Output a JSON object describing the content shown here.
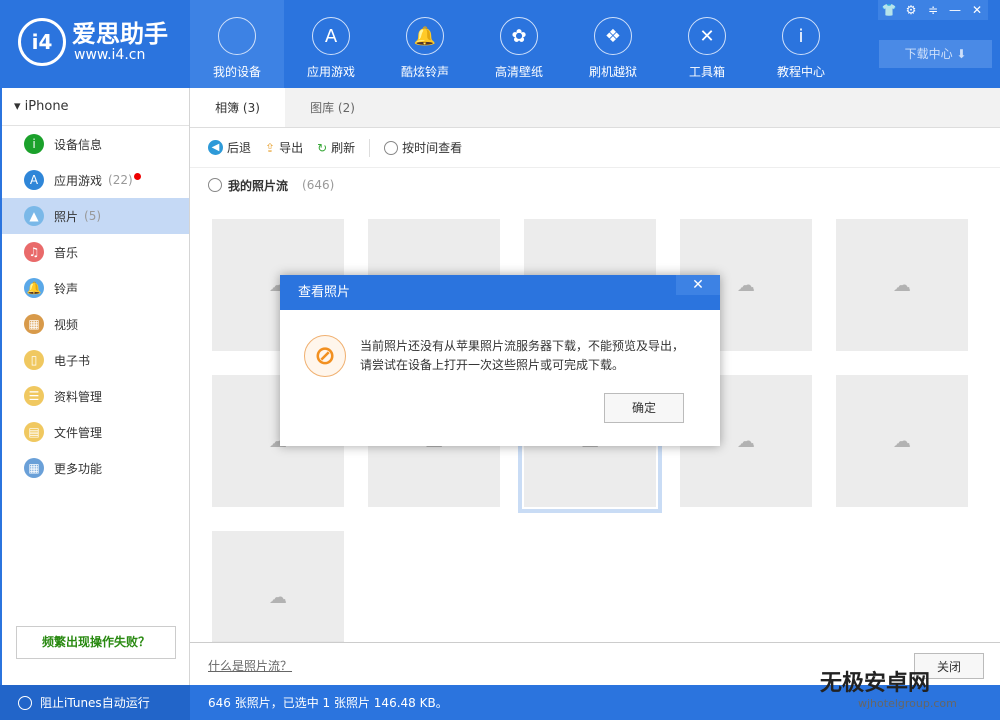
{
  "header": {
    "logo_title": "爱思助手",
    "logo_url": "www.i4.cn",
    "logo_mark": "i4",
    "nav": [
      {
        "label": "我的设备",
        "icon": "apple-icon",
        "glyph": ""
      },
      {
        "label": "应用游戏",
        "icon": "app-store-icon",
        "glyph": "A"
      },
      {
        "label": "酷炫铃声",
        "icon": "bell-icon",
        "glyph": "🔔"
      },
      {
        "label": "高清壁纸",
        "icon": "flower-icon",
        "glyph": "✿"
      },
      {
        "label": "刷机越狱",
        "icon": "box-icon",
        "glyph": "❖"
      },
      {
        "label": "工具箱",
        "icon": "tools-icon",
        "glyph": "✕"
      },
      {
        "label": "教程中心",
        "icon": "info-icon",
        "glyph": "i"
      }
    ],
    "window_buttons": [
      "👕",
      "⚙",
      "≑",
      "—",
      "✕"
    ],
    "download_center": "下载中心 ⬇"
  },
  "sidebar": {
    "device": "iPhone",
    "items": [
      {
        "label": "设备信息",
        "count": "",
        "color": "#1ba12b",
        "glyph": "i"
      },
      {
        "label": "应用游戏",
        "count": "(22)",
        "color": "#2f86d8",
        "glyph": "A"
      },
      {
        "label": "照片",
        "count": "(5)",
        "color": "#7ab8e8",
        "glyph": "▲"
      },
      {
        "label": "音乐",
        "count": "",
        "color": "#e96a6a",
        "glyph": "♫"
      },
      {
        "label": "铃声",
        "count": "",
        "color": "#5aa8e8",
        "glyph": "🔔"
      },
      {
        "label": "视频",
        "count": "",
        "color": "#d89a4a",
        "glyph": "▦"
      },
      {
        "label": "电子书",
        "count": "",
        "color": "#f0c860",
        "glyph": "▯"
      },
      {
        "label": "资料管理",
        "count": "",
        "color": "#f0c860",
        "glyph": "☰"
      },
      {
        "label": "文件管理",
        "count": "",
        "color": "#f0c860",
        "glyph": "▤"
      },
      {
        "label": "更多功能",
        "count": "",
        "color": "#6aa0d8",
        "glyph": "▦"
      }
    ],
    "help": "频繁出现操作失败？"
  },
  "main": {
    "tabs": [
      "相簿 (3)",
      "图库 (2)"
    ],
    "toolbar": {
      "back": "后退",
      "export": "导出",
      "refresh": "刷新",
      "by_time": "按时间查看"
    },
    "stream": {
      "label": "我的照片流",
      "count": "(646)"
    },
    "footer": {
      "link": "什么是照片流？",
      "close": "关闭"
    }
  },
  "dialog": {
    "title": "查看照片",
    "close": "✕",
    "message_line1": "当前照片还没有从苹果照片流服务器下载，不能预览及导出，",
    "message_line2": "请尝试在设备上打开一次这些照片或可完成下载。",
    "ok": "确定"
  },
  "status": {
    "itunes": "阻止iTunes自动运行",
    "summary": "646 张照片，已选中 1 张照片 146.48 KB。"
  },
  "watermark": {
    "name": "无极安卓网",
    "url": "wjhotelgroup.com"
  }
}
